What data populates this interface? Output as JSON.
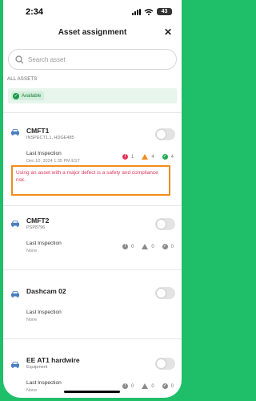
{
  "status_bar": {
    "time": "2:34",
    "battery": "43"
  },
  "header": {
    "title": "Asset assignment",
    "close": "✕"
  },
  "search": {
    "placeholder": "Search asset",
    "value": ""
  },
  "section_label": "ALL ASSETS",
  "filter": {
    "chip_label": "Available",
    "chip_icon": "check-icon"
  },
  "colors": {
    "accent": "#1fbf6a",
    "major": "#e0365a",
    "minor": "#f28c1c",
    "ok": "#1fa84f",
    "neutral": "#8a8a8a"
  },
  "assets": [
    {
      "name": "CMFT1",
      "subtitle": "INSPECT1.1, HDGE485",
      "enabled": false,
      "inspection_label": "Last Inspection",
      "inspection_value": "Dec 10, 2024 1:35 PM EST",
      "major": "1",
      "minor": "4",
      "ok": "4",
      "warning": "Using an asset with a major defect is a safety and compliance risk."
    },
    {
      "name": "CMFT2",
      "subtitle": "PSP8796",
      "enabled": false,
      "inspection_label": "Last Inspection",
      "inspection_value": "None",
      "major": "0",
      "minor": "0",
      "ok": "0"
    },
    {
      "name": "Dashcam 02",
      "enabled": false,
      "inspection_label": "Last Inspection",
      "inspection_value": "None"
    },
    {
      "name": "EE AT1 hardwire",
      "subtitle": "Equipment",
      "enabled": false,
      "inspection_label": "Last Inspection",
      "inspection_value": "None",
      "major": "0",
      "minor": "0",
      "ok": "0"
    }
  ]
}
